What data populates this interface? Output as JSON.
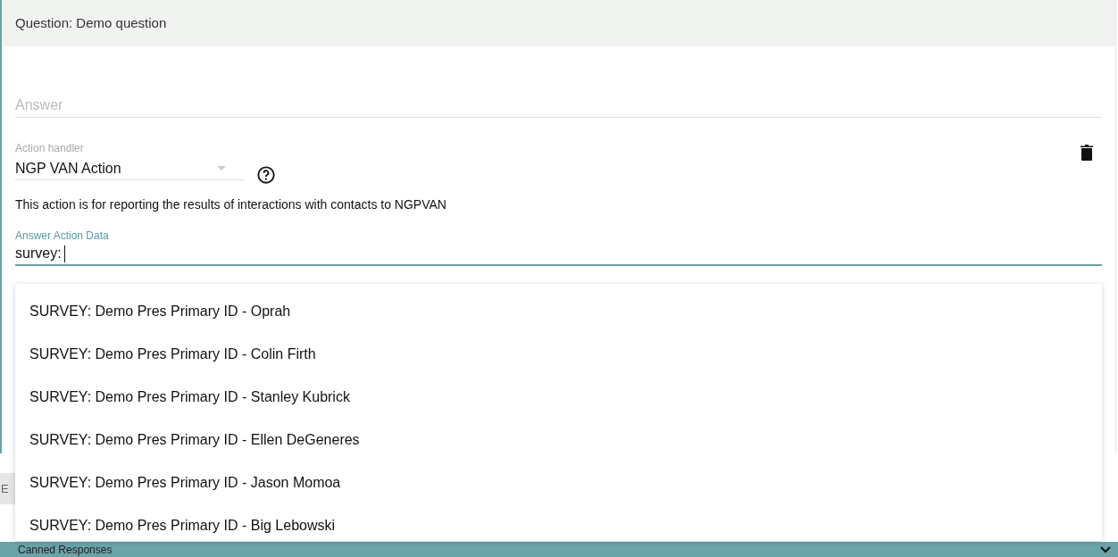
{
  "question_header": "Question: Demo question",
  "answer_field": {
    "placeholder": "Answer"
  },
  "action_handler": {
    "label": "Action handler",
    "value": "NGP VAN Action"
  },
  "action_description": "This action is for reporting the results of interactions with contacts to NGPVAN",
  "answer_action_data": {
    "label": "Answer Action Data",
    "value": "survey:",
    "focused": true
  },
  "suggestions": [
    {
      "label": "SURVEY: Demo Pres Primary ID - Oprah"
    },
    {
      "label": "SURVEY: Demo Pres Primary ID - Colin Firth"
    },
    {
      "label": "SURVEY: Demo Pres Primary ID - Stanley Kubrick"
    },
    {
      "label": "SURVEY: Demo Pres Primary ID - Ellen DeGeneres"
    },
    {
      "label": "SURVEY: Demo Pres Primary ID - Jason Momoa"
    },
    {
      "label": "SURVEY: Demo Pres Primary ID - Big Lebowski"
    }
  ],
  "partial_button": {
    "label": "E"
  },
  "canned_responses_bar": {
    "label": "Canned Responses"
  }
}
